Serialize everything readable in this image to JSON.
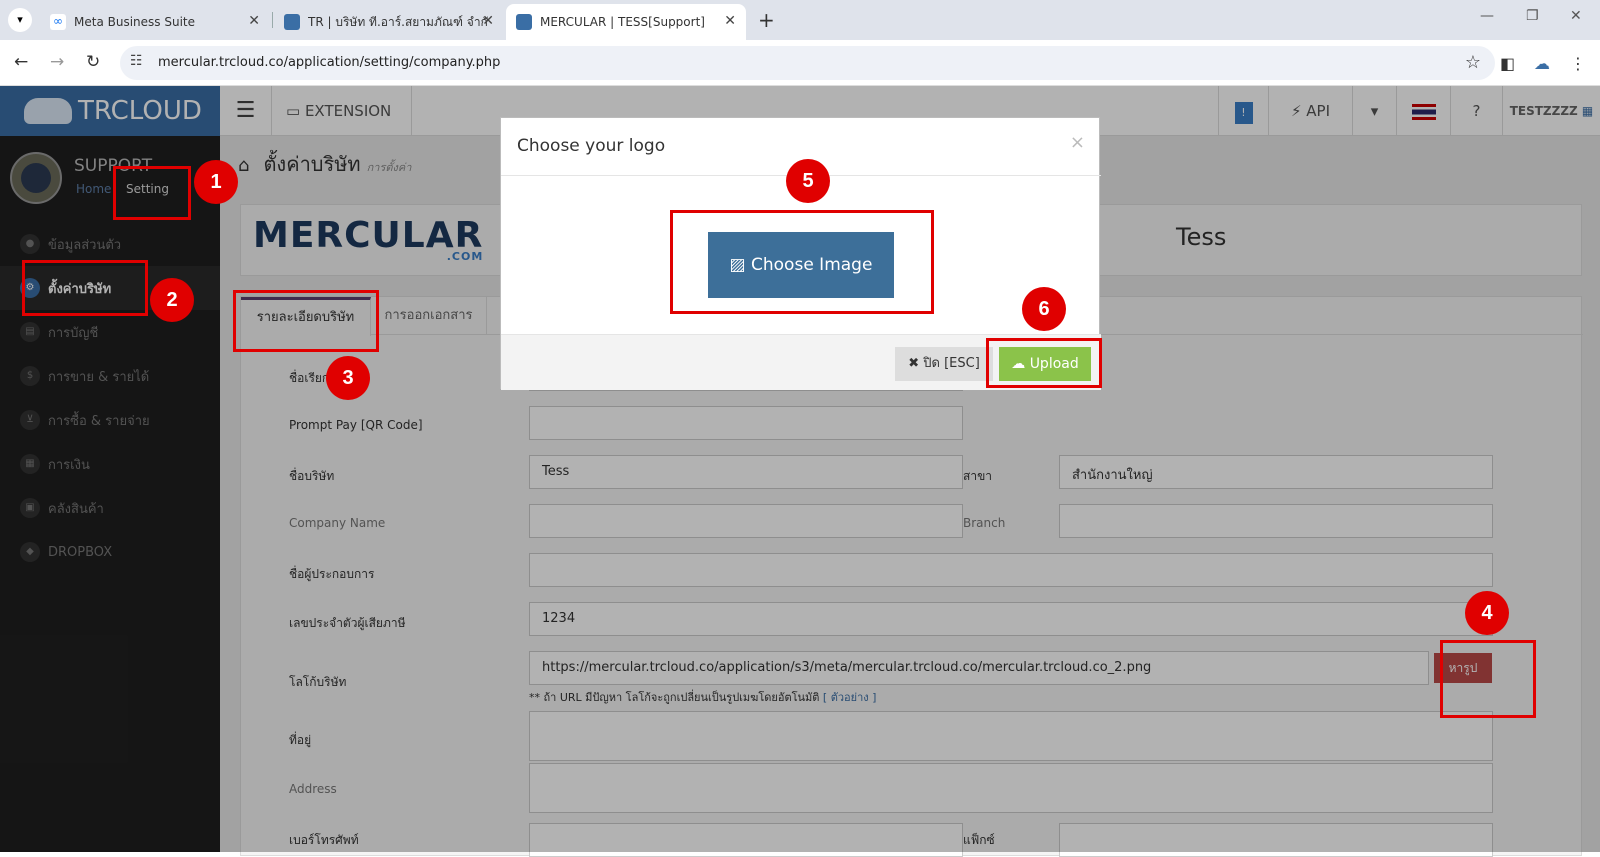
{
  "browser": {
    "tabs": [
      {
        "title": "Meta Business Suite",
        "active": false
      },
      {
        "title": "TR | บริษัท ที.อาร์.สยามภัณฑ์ จำกัด",
        "active": false
      },
      {
        "title": "MERCULAR | TESS[Support]",
        "active": true
      }
    ],
    "new_tab": "+",
    "url": "mercular.trcloud.co/application/setting/company.php"
  },
  "app": {
    "brand": "TRCLOUD",
    "extension_label": "EXTENSION",
    "api_label": "API",
    "user_label": "TESTZZZZ"
  },
  "sidebar": {
    "user_name": "SUPPORT",
    "crumb_home": "Home",
    "crumb_setting": "Setting",
    "items": [
      {
        "label": "ข้อมูลส่วนตัว"
      },
      {
        "label": "ตั้งค่าบริษัท"
      },
      {
        "label": "การบัญชี"
      },
      {
        "label": "การขาย & รายได้"
      },
      {
        "label": "การซื้อ & รายจ่าย"
      },
      {
        "label": "การเงิน"
      },
      {
        "label": "คลังสินค้า"
      },
      {
        "label": "DROPBOX"
      }
    ]
  },
  "page": {
    "title": "ตั้งค่าบริษัท",
    "subtitle": "การตั้งค่า",
    "company_logo_text": "MERCULAR",
    "company_logo_sub": ".COM",
    "company_name": "Tess",
    "tabs": [
      "รายละเอียดบริษัท",
      "การออกเอกสาร"
    ],
    "form": {
      "call_name_label": "ชื่อเรียก",
      "promptpay_label": "Prompt Pay [QR Code]",
      "company_name_label": "ชื่อบริษัท",
      "company_name_value": "Tess",
      "branch_label": "สาขา",
      "branch_value": "สำนักงานใหญ่",
      "company_name_en_label": "Company Name",
      "branch_en_label": "Branch",
      "operator_label": "ชื่อผู้ประกอบการ",
      "tax_id_label": "เลขประจำตัวผู้เสียภาษี",
      "tax_id_value": "1234",
      "logo_label": "โลโก้บริษัท",
      "logo_url": "https://mercular.trcloud.co/application/s3/meta/mercular.trcloud.co/mercular.trcloud.co_2.png",
      "logo_button": "หารูป",
      "logo_note": "** ถ้า URL มีปัญหา โลโก้จะถูกเปลี่ยนเป็นรูปเมฆโดยอัตโนมัติ",
      "logo_note_link": "[ ตัวอย่าง ]",
      "address_label": "ที่อยู่",
      "address_en_label": "Address",
      "phone_label": "เบอร์โทรศัพท์",
      "fax_label": "แฟ็กซ์"
    }
  },
  "modal": {
    "title": "Choose your logo",
    "close_x": "×",
    "choose_button": "Choose Image",
    "close_button": "ปิด [ESC]",
    "upload_button": "Upload"
  },
  "annotations": [
    "1",
    "2",
    "3",
    "4",
    "5",
    "6"
  ],
  "colors": {
    "brand_blue": "#3a6ea5",
    "sidebar_bg": "#1f1f1f",
    "upload_green": "#8bc34a",
    "danger_red": "#b94a48",
    "annotation_red": "#e00000"
  }
}
